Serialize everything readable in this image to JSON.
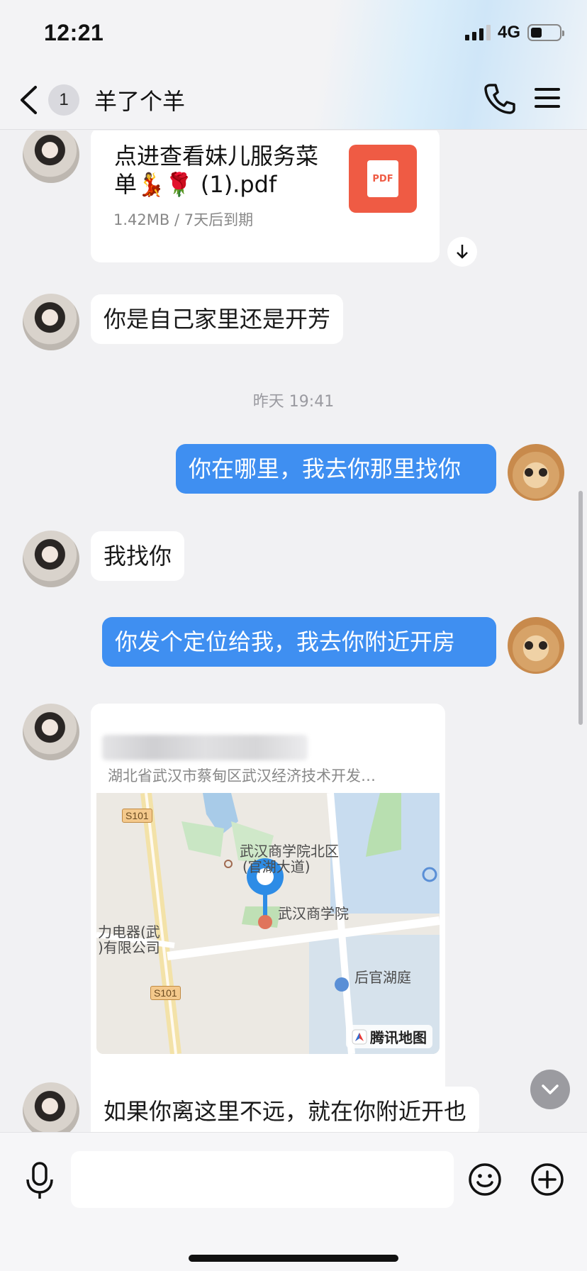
{
  "status_bar": {
    "time": "12:21",
    "network": "4G",
    "battery_level": 0.4
  },
  "header": {
    "back_count": "1",
    "title": "羊了个羊"
  },
  "messages": {
    "file": {
      "name": "点进查看妹儿服务菜单💃🌹 (1).pdf",
      "meta": "1.42MB / 7天后到期",
      "file_icon_label": "PDF"
    },
    "msg1": "你是自己家里还是开芳",
    "timestamp": "昨天 19:41",
    "msg2": "你在哪里，我去你那里找你",
    "msg3": "我找你",
    "msg4": "你发个定位给我，我去你附近开房",
    "location": {
      "address": "湖北省武汉市蔡甸区武汉经济技术开发…",
      "map_labels": {
        "road_1": "S101",
        "road_2": "S101",
        "poi_north": "武汉商学院北区",
        "poi_north_sub": "(官湖大道)",
        "poi_main": "武汉商学院",
        "poi_left_1": "力电器(武",
        "poi_left_2": ")有限公司",
        "poi_right": "后官湖庭",
        "logo": "腾讯地图"
      }
    },
    "msg5": "如果你离这里不远，就在你附近开也"
  },
  "icons": {
    "back": "chevron-left-icon",
    "phone": "phone-icon",
    "menu": "menu-icon",
    "download": "download-icon",
    "scroll_down": "chevron-down-icon",
    "mic": "microphone-icon",
    "emoji": "smiley-icon",
    "plus": "plus-circle-icon"
  },
  "colors": {
    "accent_bubble": "#3f8ff1",
    "pdf_icon": "#ef5b44",
    "background": "#f1f1f3"
  }
}
